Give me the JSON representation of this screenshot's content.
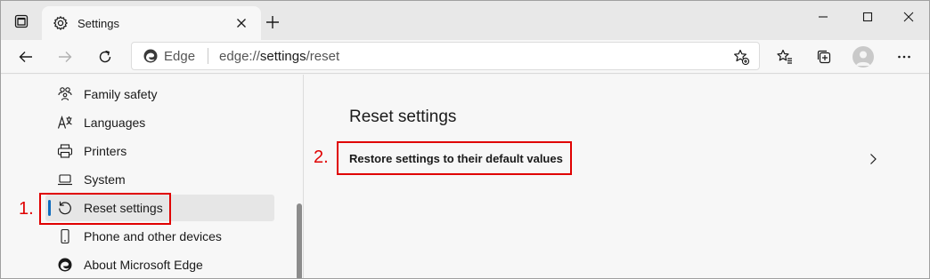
{
  "tab": {
    "title": "Settings"
  },
  "address": {
    "brand": "Edge",
    "scheme": "edge://",
    "host": "settings",
    "path": "/reset"
  },
  "sidebar": {
    "items": [
      {
        "label": "Family safety",
        "icon": "family-icon"
      },
      {
        "label": "Languages",
        "icon": "languages-icon"
      },
      {
        "label": "Printers",
        "icon": "printer-icon"
      },
      {
        "label": "System",
        "icon": "laptop-icon"
      },
      {
        "label": "Reset settings",
        "icon": "reset-icon",
        "active": true
      },
      {
        "label": "Phone and other devices",
        "icon": "phone-icon"
      },
      {
        "label": "About Microsoft Edge",
        "icon": "edge-icon"
      }
    ]
  },
  "main": {
    "section_title": "Reset settings",
    "restore_label": "Restore settings to their default values"
  },
  "annotations": {
    "step1": "1.",
    "step2": "2."
  },
  "colors": {
    "accent": "#0f6cbd",
    "annotation": "#e00000",
    "background": "#f7f7f7"
  }
}
